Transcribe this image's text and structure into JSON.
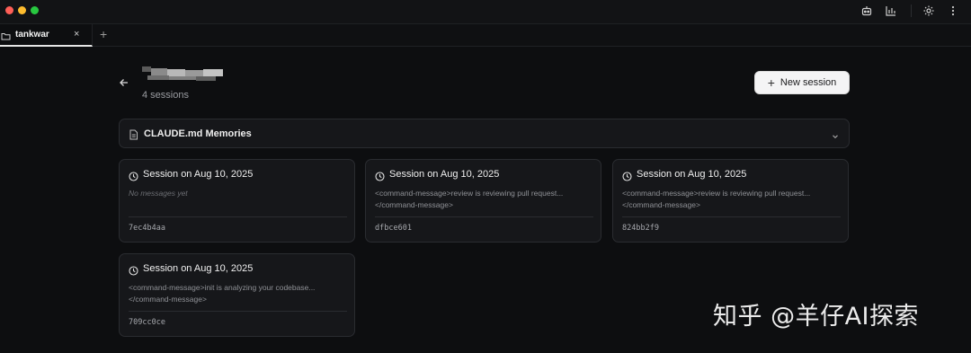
{
  "window": {
    "icons": [
      "robot-icon",
      "bar-chart-icon",
      "settings-icon",
      "more-vertical-icon"
    ]
  },
  "tabs": [
    {
      "label": "tankwar",
      "close": "×"
    }
  ],
  "tab_add": "+",
  "project": {
    "title": "",
    "sessions_count": "4 sessions"
  },
  "actions": {
    "new_session_label": "New session",
    "new_session_plus": "+"
  },
  "memories": {
    "label": "CLAUDE.md Memories"
  },
  "sessions": [
    {
      "title": "Session on Aug 10, 2025",
      "preview": "No messages yet",
      "id": "7ec4b4aa"
    },
    {
      "title": "Session on Aug 10, 2025",
      "preview": "<command-message>review is reviewing pull request... </command-message>",
      "id": "dfbce601"
    },
    {
      "title": "Session on Aug 10, 2025",
      "preview": "<command-message>review is reviewing pull request... </command-message>",
      "id": "824bb2f9"
    },
    {
      "title": "Session on Aug 10, 2025",
      "preview": "<command-message>init is analyzing your codebase... </command-message>",
      "id": "709cc0ce"
    }
  ],
  "watermark": "知乎 @羊仔AI探索",
  "colors": {
    "background": "#0d0e10",
    "card": "#16171a",
    "border": "#2a2c30",
    "button_bg": "#f4f4f5"
  }
}
